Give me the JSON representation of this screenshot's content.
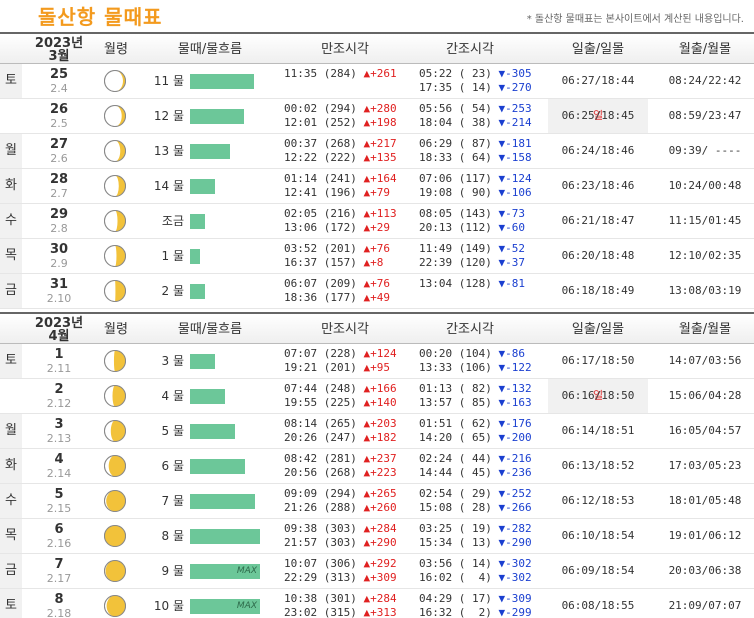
{
  "page": {
    "title": "돌산항 물때표",
    "note": "* 돌산항 물때표는 본사이트에서 계산된 내용입니다."
  },
  "headers": {
    "moon": "월령",
    "mul": "물때/물흐름",
    "high": "만조시각",
    "low": "간조시각",
    "sun": "일출/일몰",
    "moonrise": "월출/월몰"
  },
  "months": [
    {
      "year": "2023년",
      "month": "3월",
      "rows": [
        {
          "dow": "토",
          "day": "25",
          "lunar": "2.4",
          "phase": 0.12,
          "mul": "11 물",
          "bar": 0.85,
          "max": false,
          "high": [
            {
              "t": "11:35",
              "h": "(284)",
              "d": "▲+261"
            }
          ],
          "low": [
            {
              "t": "05:22",
              "h": "( 23)",
              "d": "▼-305"
            },
            {
              "t": "17:35",
              "h": "( 14)",
              "d": "▼-270"
            }
          ],
          "sun": "06:27/18:44",
          "mr": "08:24/22:42"
        },
        {
          "dow": "일",
          "day": "26",
          "lunar": "2.5",
          "phase": 0.18,
          "mul": "12 물",
          "bar": 0.72,
          "max": false,
          "high": [
            {
              "t": "00:02",
              "h": "(294)",
              "d": "▲+280"
            },
            {
              "t": "12:01",
              "h": "(252)",
              "d": "▲+198"
            }
          ],
          "low": [
            {
              "t": "05:56",
              "h": "( 54)",
              "d": "▼-253"
            },
            {
              "t": "18:04",
              "h": "( 38)",
              "d": "▼-214"
            }
          ],
          "sun": "06:25/18:45",
          "mr": "08:59/23:47"
        },
        {
          "dow": "월",
          "day": "27",
          "lunar": "2.6",
          "phase": 0.25,
          "mul": "13 물",
          "bar": 0.53,
          "max": false,
          "high": [
            {
              "t": "00:37",
              "h": "(268)",
              "d": "▲+217"
            },
            {
              "t": "12:22",
              "h": "(222)",
              "d": "▲+135"
            }
          ],
          "low": [
            {
              "t": "06:29",
              "h": "( 87)",
              "d": "▼-181"
            },
            {
              "t": "18:33",
              "h": "( 64)",
              "d": "▼-158"
            }
          ],
          "sun": "06:24/18:46",
          "mr": "09:39/ ----"
        },
        {
          "dow": "화",
          "day": "28",
          "lunar": "2.7",
          "phase": 0.32,
          "mul": "14 물",
          "bar": 0.33,
          "max": false,
          "high": [
            {
              "t": "01:14",
              "h": "(241)",
              "d": "▲+164"
            },
            {
              "t": "12:41",
              "h": "(196)",
              "d": "▲+79"
            }
          ],
          "low": [
            {
              "t": "07:06",
              "h": "(117)",
              "d": "▼-124"
            },
            {
              "t": "19:08",
              "h": "( 90)",
              "d": "▼-106"
            }
          ],
          "sun": "06:23/18:46",
          "mr": "10:24/00:48"
        },
        {
          "dow": "수",
          "day": "29",
          "lunar": "2.8",
          "phase": 0.38,
          "mul": "조금",
          "bar": 0.2,
          "max": false,
          "high": [
            {
              "t": "02:05",
              "h": "(216)",
              "d": "▲+113"
            },
            {
              "t": "13:06",
              "h": "(172)",
              "d": "▲+29"
            }
          ],
          "low": [
            {
              "t": "08:05",
              "h": "(143)",
              "d": "▼-73"
            },
            {
              "t": "20:13",
              "h": "(112)",
              "d": "▼-60"
            }
          ],
          "sun": "06:21/18:47",
          "mr": "11:15/01:45"
        },
        {
          "dow": "목",
          "day": "30",
          "lunar": "2.9",
          "phase": 0.43,
          "mul": "1 물",
          "bar": 0.13,
          "max": false,
          "high": [
            {
              "t": "03:52",
              "h": "(201)",
              "d": "▲+76"
            },
            {
              "t": "16:37",
              "h": "(157)",
              "d": "▲+8"
            }
          ],
          "low": [
            {
              "t": "11:49",
              "h": "(149)",
              "d": "▼-52"
            },
            {
              "t": "22:39",
              "h": "(120)",
              "d": "▼-37"
            }
          ],
          "sun": "06:20/18:48",
          "mr": "12:10/02:35"
        },
        {
          "dow": "금",
          "day": "31",
          "lunar": "2.10",
          "phase": 0.48,
          "mul": "2 물",
          "bar": 0.2,
          "max": false,
          "high": [
            {
              "t": "06:07",
              "h": "(209)",
              "d": "▲+76"
            },
            {
              "t": "18:36",
              "h": "(177)",
              "d": "▲+49"
            }
          ],
          "low": [
            {
              "t": "13:04",
              "h": "(128)",
              "d": "▼-81"
            }
          ],
          "sun": "06:18/18:49",
          "mr": "13:08/03:19"
        }
      ]
    },
    {
      "year": "2023년",
      "month": "4월",
      "rows": [
        {
          "dow": "토",
          "day": "1",
          "lunar": "2.11",
          "phase": 0.55,
          "mul": "3 물",
          "bar": 0.33,
          "max": false,
          "high": [
            {
              "t": "07:07",
              "h": "(228)",
              "d": "▲+124"
            },
            {
              "t": "19:21",
              "h": "(201)",
              "d": "▲+95"
            }
          ],
          "low": [
            {
              "t": "00:20",
              "h": "(104)",
              "d": "▼-86"
            },
            {
              "t": "13:33",
              "h": "(106)",
              "d": "▼-122"
            }
          ],
          "sun": "06:17/18:50",
          "mr": "14:07/03:56"
        },
        {
          "dow": "일",
          "day": "2",
          "lunar": "2.12",
          "phase": 0.62,
          "mul": "4 물",
          "bar": 0.47,
          "max": false,
          "high": [
            {
              "t": "07:44",
              "h": "(248)",
              "d": "▲+166"
            },
            {
              "t": "19:55",
              "h": "(225)",
              "d": "▲+140"
            }
          ],
          "low": [
            {
              "t": "01:13",
              "h": "( 82)",
              "d": "▼-132"
            },
            {
              "t": "13:57",
              "h": "( 85)",
              "d": "▼-163"
            }
          ],
          "sun": "06:16/18:50",
          "mr": "15:06/04:28"
        },
        {
          "dow": "월",
          "day": "3",
          "lunar": "2.13",
          "phase": 0.7,
          "mul": "5 물",
          "bar": 0.6,
          "max": false,
          "high": [
            {
              "t": "08:14",
              "h": "(265)",
              "d": "▲+203"
            },
            {
              "t": "20:26",
              "h": "(247)",
              "d": "▲+182"
            }
          ],
          "low": [
            {
              "t": "01:51",
              "h": "( 62)",
              "d": "▼-176"
            },
            {
              "t": "14:20",
              "h": "( 65)",
              "d": "▼-200"
            }
          ],
          "sun": "06:14/18:51",
          "mr": "16:05/04:57"
        },
        {
          "dow": "화",
          "day": "4",
          "lunar": "2.14",
          "phase": 0.8,
          "mul": "6 물",
          "bar": 0.73,
          "max": false,
          "high": [
            {
              "t": "08:42",
              "h": "(281)",
              "d": "▲+237"
            },
            {
              "t": "20:56",
              "h": "(268)",
              "d": "▲+223"
            }
          ],
          "low": [
            {
              "t": "02:24",
              "h": "( 44)",
              "d": "▼-216"
            },
            {
              "t": "14:44",
              "h": "( 45)",
              "d": "▼-236"
            }
          ],
          "sun": "06:13/18:52",
          "mr": "17:03/05:23"
        },
        {
          "dow": "수",
          "day": "5",
          "lunar": "2.15",
          "phase": 0.92,
          "mul": "7 물",
          "bar": 0.87,
          "max": false,
          "high": [
            {
              "t": "09:09",
              "h": "(294)",
              "d": "▲+265"
            },
            {
              "t": "21:26",
              "h": "(288)",
              "d": "▲+260"
            }
          ],
          "low": [
            {
              "t": "02:54",
              "h": "( 29)",
              "d": "▼-252"
            },
            {
              "t": "15:08",
              "h": "( 28)",
              "d": "▼-266"
            }
          ],
          "sun": "06:12/18:53",
          "mr": "18:01/05:48"
        },
        {
          "dow": "목",
          "day": "6",
          "lunar": "2.16",
          "phase": 1.0,
          "mul": "8 물",
          "bar": 0.93,
          "max": false,
          "high": [
            {
              "t": "09:38",
              "h": "(303)",
              "d": "▲+284"
            },
            {
              "t": "21:57",
              "h": "(303)",
              "d": "▲+290"
            }
          ],
          "low": [
            {
              "t": "03:25",
              "h": "( 19)",
              "d": "▼-282"
            },
            {
              "t": "15:34",
              "h": "( 13)",
              "d": "▼-290"
            }
          ],
          "sun": "06:10/18:54",
          "mr": "19:01/06:12"
        },
        {
          "dow": "금",
          "day": "7",
          "lunar": "2.17",
          "phase": 0.95,
          "mul": "9 물",
          "bar": 0.93,
          "max": true,
          "high": [
            {
              "t": "10:07",
              "h": "(306)",
              "d": "▲+292"
            },
            {
              "t": "22:29",
              "h": "(313)",
              "d": "▲+309"
            }
          ],
          "low": [
            {
              "t": "03:56",
              "h": "( 14)",
              "d": "▼-302"
            },
            {
              "t": "16:02",
              "h": "(  4)",
              "d": "▼-302"
            }
          ],
          "sun": "06:09/18:54",
          "mr": "20:03/06:38"
        },
        {
          "dow": "토",
          "day": "8",
          "lunar": "2.18",
          "phase": 0.9,
          "mul": "10 물",
          "bar": 0.93,
          "max": true,
          "high": [
            {
              "t": "10:38",
              "h": "(301)",
              "d": "▲+284"
            },
            {
              "t": "23:02",
              "h": "(315)",
              "d": "▲+313"
            }
          ],
          "low": [
            {
              "t": "04:29",
              "h": "( 17)",
              "d": "▼-309"
            },
            {
              "t": "16:32",
              "h": "(  2)",
              "d": "▼-299"
            }
          ],
          "sun": "06:08/18:55",
          "mr": "21:09/07:07"
        }
      ]
    }
  ],
  "max_label": "MAX",
  "colors": {
    "title": "#f39a1e",
    "bar": "#6cc799",
    "up": "#e02020",
    "down": "#1a3fd0",
    "moon_lit": "#f2c23a"
  }
}
